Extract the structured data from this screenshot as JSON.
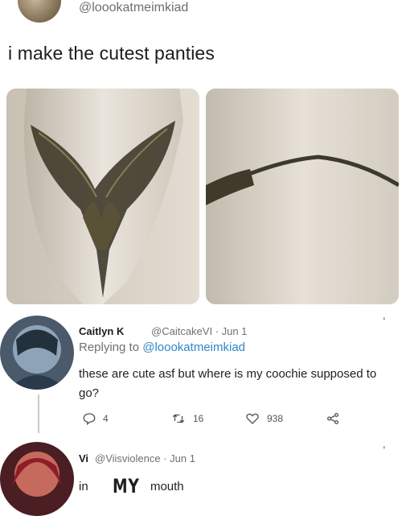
{
  "top_tweet": {
    "handle": "@loookatmeimkiad",
    "text": "i make the cutest panties"
  },
  "reply": {
    "name": "Caitlyn K",
    "handle_date": "@CaitcakeVI · Jun 1",
    "replying_prefix": "Replying to ",
    "replying_target": "@loookatmeimkiad",
    "text": "these are cute asf but where is my coochie supposed to go?",
    "more": "...",
    "counts": {
      "replies": "4",
      "retweets": "16",
      "likes": "938"
    }
  },
  "second_reply": {
    "name": "Vi",
    "handle_date": "@Viisviolence · Jun 1",
    "more": "...",
    "word1": "in",
    "word2": "MY",
    "word3": "mouth"
  },
  "colors": {
    "link": "#2f86c9",
    "muted": "#707070"
  }
}
